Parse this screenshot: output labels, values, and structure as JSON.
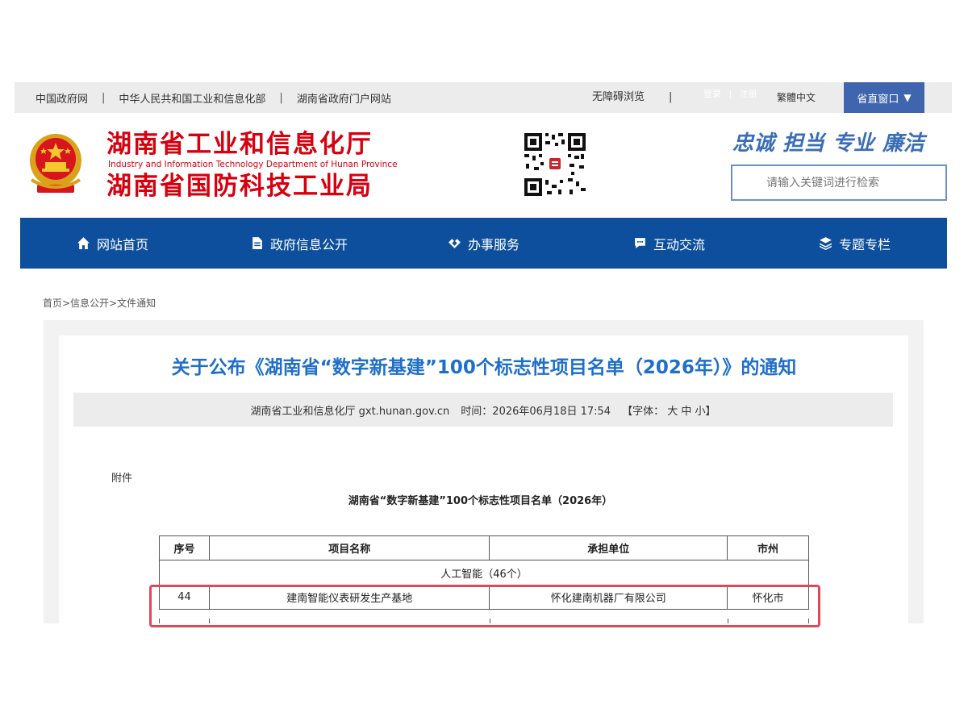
{
  "topbar": {
    "links": [
      "中国政府网",
      "中华人民共和国工业和信息化部",
      "湖南省政府门户网站"
    ],
    "separator": "|",
    "accessibility": "无障碍浏览",
    "login": "登录",
    "register": "注册",
    "traditional": "繁體中文",
    "province_window": "省直窗口",
    "province_caret": "▼"
  },
  "header": {
    "name_line1": "湖南省工业和信息化厅",
    "name_en": "Industry and Information Technology Department of Hunan Province",
    "name_line2": "湖南省国防科技工业局",
    "slogans": [
      "忠诚",
      "担当",
      "专业",
      "廉洁"
    ],
    "search_placeholder": "请输入关键词进行检索",
    "colors": {
      "brand_red": "#d7000f",
      "nav_blue": "#0d4f9c",
      "title_blue": "#1f6fc8"
    }
  },
  "nav": {
    "items": [
      {
        "label": "网站首页",
        "icon": "home-icon"
      },
      {
        "label": "政府信息公开",
        "icon": "document-icon"
      },
      {
        "label": "办事服务",
        "icon": "handshake-icon"
      },
      {
        "label": "互动交流",
        "icon": "chat-icon"
      },
      {
        "label": "专题专栏",
        "icon": "layers-icon"
      }
    ]
  },
  "breadcrumb": "首页>信息公开>文件通知",
  "article": {
    "title": "关于公布《湖南省“数字新基建”100个标志性项目名单（2026年）》的通知",
    "source": "湖南省工业和信息化厅 gxt.hunan.gov.cn",
    "time": "时间：2026年06月18日 17:54",
    "font_size": "【字体： 大 中 小】",
    "attachment_label": "附件",
    "list_title": "湖南省“数字新基建”100个标志性项目名单（2026年）"
  },
  "table": {
    "headers": [
      "序号",
      "项目名称",
      "承担单位",
      "市州"
    ],
    "group": "人工智能（46个）",
    "rows": [
      [
        "44",
        "建南智能仪表研发生产基地",
        "怀化建南机器厂有限公司",
        "怀化市"
      ]
    ]
  }
}
